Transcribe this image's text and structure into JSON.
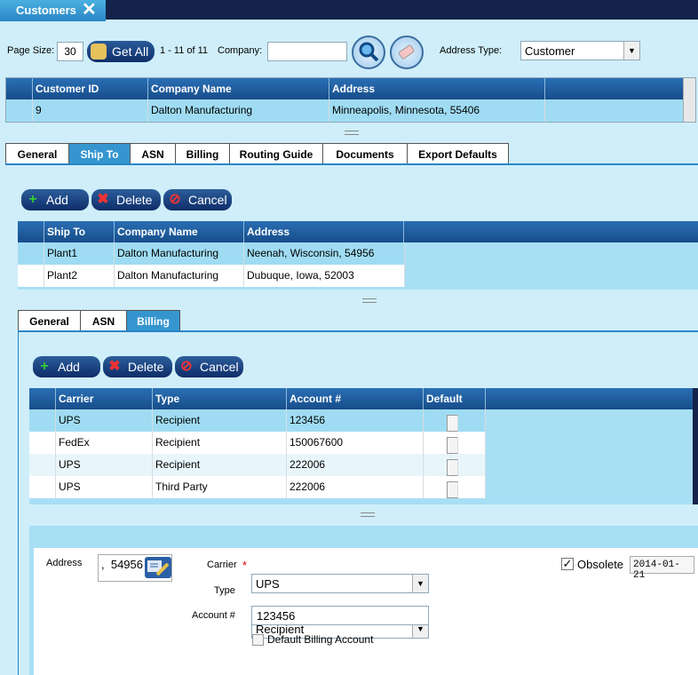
{
  "app": {
    "tab_title": "Customers"
  },
  "toolbar": {
    "page_size_label": "Page Size:",
    "page_size_value": "30",
    "get_all": "Get All",
    "range": "1 - 11 of 11",
    "company_label": "Company:",
    "company_value": "",
    "address_type_label": "Address Type:",
    "address_type_value": "Customer"
  },
  "customers": {
    "headers": [
      "Customer ID",
      "Company Name",
      "Address"
    ],
    "rows": [
      [
        "9",
        "Dalton Manufacturing",
        "Minneapolis, Minnesota, 55406"
      ]
    ]
  },
  "tabs": [
    "General",
    "Ship To",
    "ASN",
    "Billing",
    "Routing Guide",
    "Documents",
    "Export Defaults"
  ],
  "actions": {
    "add": "Add",
    "delete": "Delete",
    "cancel": "Cancel"
  },
  "shipto": {
    "headers": [
      "Ship To",
      "Company Name",
      "Address"
    ],
    "rows": [
      [
        "Plant1",
        "Dalton Manufacturing",
        "Neenah, Wisconsin, 54956"
      ],
      [
        "Plant2",
        "Dalton Manufacturing",
        "Dubuque, Iowa, 52003"
      ]
    ]
  },
  "subtabs": [
    "General",
    "ASN",
    "Billing"
  ],
  "billing": {
    "headers": [
      "Carrier",
      "Type",
      "Account #",
      "Default"
    ],
    "rows": [
      [
        "UPS",
        "Recipient",
        "123456"
      ],
      [
        "FedEx",
        "Recipient",
        "150067600"
      ],
      [
        "UPS",
        "Recipient",
        "222006"
      ],
      [
        "UPS",
        "Third Party",
        "222006"
      ]
    ]
  },
  "form": {
    "address_label": "Address",
    "address_value": ",  54956",
    "carrier_label": "Carrier",
    "carrier_value": "UPS",
    "type_label": "Type",
    "type_value": "Recipient",
    "account_label": "Account #",
    "account_value": "123456",
    "default_billing_label": "Default Billing Account",
    "obsolete_label": "Obsolete",
    "obsolete_date": "2014-01-21"
  }
}
